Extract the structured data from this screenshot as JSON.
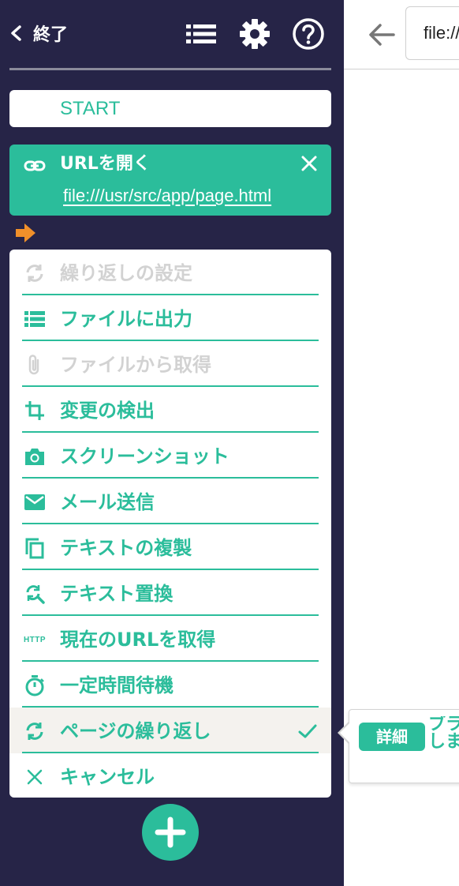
{
  "header": {
    "back_label": "終了",
    "icons": [
      "list-icon",
      "gear-icon",
      "help-icon"
    ]
  },
  "start_label": "START",
  "url_step": {
    "title": "URLを開く",
    "url": "file:///usr/src/app/page.html"
  },
  "menu": {
    "items": [
      {
        "label": "繰り返しの設定",
        "icon": "repeat-icon",
        "disabled": true
      },
      {
        "label": "ファイルに出力",
        "icon": "list-icon",
        "disabled": false
      },
      {
        "label": "ファイルから取得",
        "icon": "paperclip-icon",
        "disabled": true
      },
      {
        "label": "変更の検出",
        "icon": "crop-icon",
        "disabled": false
      },
      {
        "label": "スクリーンショット",
        "icon": "camera-icon",
        "disabled": false
      },
      {
        "label": "メール送信",
        "icon": "mail-icon",
        "disabled": false
      },
      {
        "label": "テキストの複製",
        "icon": "copy-icon",
        "disabled": false
      },
      {
        "label": "テキスト置換",
        "icon": "find-replace-icon",
        "disabled": false
      },
      {
        "label": "現在のURLを取得",
        "icon": "http-icon",
        "icon_text": "HTTP",
        "disabled": false
      },
      {
        "label": "一定時間待機",
        "icon": "timer-icon",
        "disabled": false
      },
      {
        "label": "ページの繰り返し",
        "icon": "repeat-icon",
        "disabled": false,
        "selected": true
      },
      {
        "label": "キャンセル",
        "icon": "close-icon",
        "disabled": false
      }
    ]
  },
  "browser": {
    "url_text": "file://"
  },
  "tooltip": {
    "badge": "詳細",
    "text_line1": "ブラ",
    "text_line2": "しま"
  },
  "colors": {
    "sidebar_bg": "#262447",
    "accent": "#2bbd9b",
    "arrow": "#f0902a",
    "disabled": "#d2d2d2"
  }
}
